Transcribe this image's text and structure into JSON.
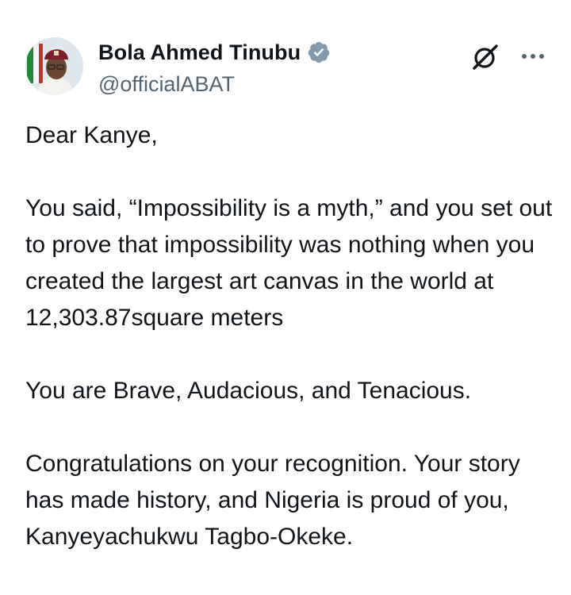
{
  "author": {
    "display_name": "Bola Ahmed Tinubu",
    "handle": "@officialABAT",
    "verified_badge_color": "#829aab",
    "avatar_icon": "profile-photo"
  },
  "actions": {
    "grok_icon": "grok-icon",
    "more_icon": "more-options-icon"
  },
  "tweet": {
    "paragraphs": [
      "Dear Kanye,",
      "You said, “Impossibility is a myth,” and you set out to prove that impossibility was nothing when you created the largest art canvas in the world at 12,303.87square meters",
      "You are Brave, Audacious, and Tenacious.",
      "Congratulations on your recognition. Your story has made history, and Nigeria is proud of you, Kanyeyachukwu Tagbo-Okeke."
    ]
  },
  "colors": {
    "text_primary": "#0f1419",
    "text_secondary": "#536471",
    "background": "#ffffff"
  }
}
